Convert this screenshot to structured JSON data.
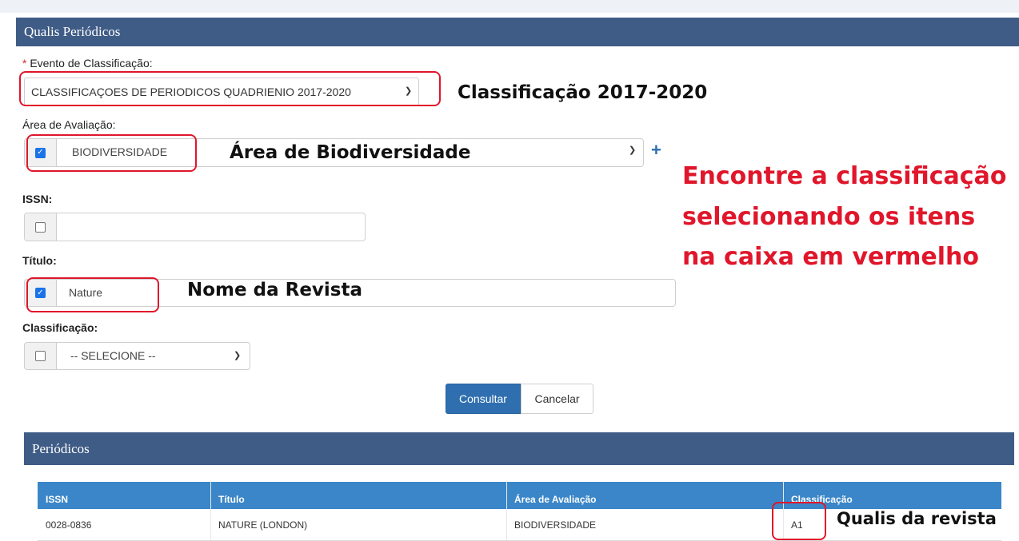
{
  "panel": {
    "title": "Qualis Periódicos"
  },
  "evento": {
    "label": "Evento de Classificação:",
    "required_mark": "*",
    "value": "CLASSIFICAÇOES DE PERIODICOS QUADRIENIO 2017-2020"
  },
  "area": {
    "label": "Área de Avaliação:",
    "value": "BIODIVERSIDADE",
    "checked": true
  },
  "issn": {
    "label": "ISSN:",
    "value": "",
    "checked": false
  },
  "titulo": {
    "label": "Título:",
    "value": "Nature",
    "checked": true
  },
  "classificacao": {
    "label": "Classificação:",
    "value": "-- SELECIONE --",
    "checked": false
  },
  "buttons": {
    "consultar": "Consultar",
    "cancelar": "Cancelar"
  },
  "results": {
    "title": "Periódicos",
    "columns": [
      "ISSN",
      "Título",
      "Área de Avaliação",
      "Classificação"
    ],
    "rows": [
      [
        "0028-0836",
        "NATURE (LONDON)",
        "BIODIVERSIDADE",
        "A1"
      ]
    ]
  },
  "annotations": {
    "classificacao": "Classificação 2017-2020",
    "area": "Área de Biodiversidade",
    "revista": "Nome da Revista",
    "qualis": "Qualis da revista",
    "instr_line1": "Encontre a classificação",
    "instr_line2": "selecionando os itens",
    "instr_line3": "na caixa em vermelho"
  },
  "colors": {
    "header": "#3f5c86",
    "table_header": "#3a86c8",
    "primary": "#2f6fb0",
    "annotation_red": "#e0162b"
  }
}
